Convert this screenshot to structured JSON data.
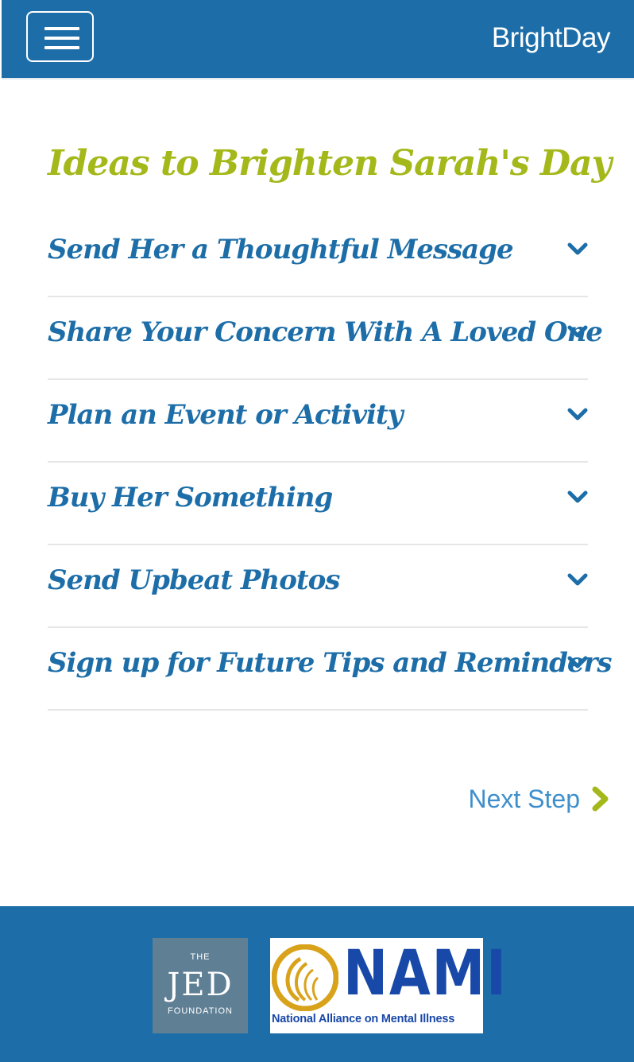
{
  "navbar": {
    "brand": "BrightDay",
    "bg_color": "#1d6ea8",
    "menu_icon": "hamburger-icon"
  },
  "main": {
    "title": "Ideas to Brighten Sarah's Day",
    "title_color": "#a4b81a",
    "accordion": [
      {
        "label": "Send Her a Thoughtful Message",
        "icon": "chevron-down-icon"
      },
      {
        "label": "Share Your Concern With A Loved One",
        "icon": "chevron-down-icon"
      },
      {
        "label": "Plan an Event or Activity",
        "icon": "chevron-down-icon"
      },
      {
        "label": "Buy Her Something",
        "icon": "chevron-down-icon"
      },
      {
        "label": "Send Upbeat Photos",
        "icon": "chevron-down-icon"
      },
      {
        "label": "Sign up for Future Tips and Reminders",
        "icon": "chevron-down-icon"
      }
    ],
    "next_step": {
      "label": "Next Step",
      "icon": "chevron-right-icon",
      "icon_color": "#a4b81a"
    }
  },
  "footer": {
    "bg_color": "#1d6ea8",
    "jed_logo": {
      "the": "THE",
      "name": "JED",
      "foundation": "FOUNDATION"
    },
    "nami_logo": {
      "name": "NAMI",
      "tagline": "National Alliance on Mental Illness"
    }
  }
}
